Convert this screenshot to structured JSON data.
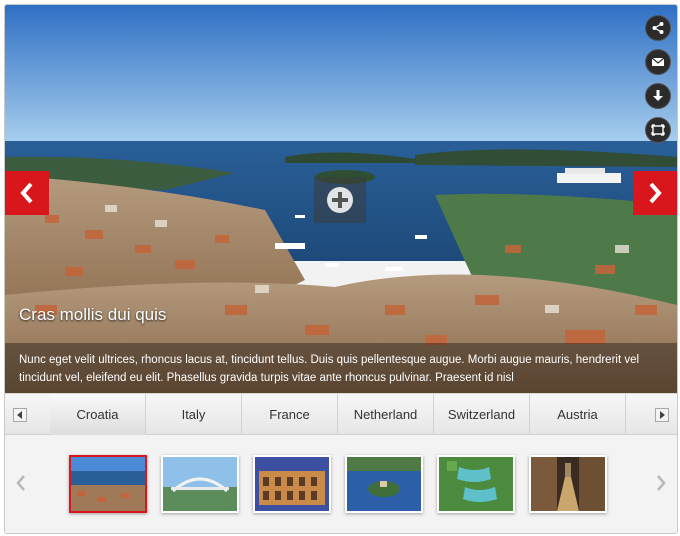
{
  "slide": {
    "title": "Cras mollis dui quis",
    "description": "Nunc eget velit ultrices, rhoncus lacus at, tincidunt tellus. Duis quis pellentesque augue. Morbi augue mauris, hendrerit vel tincidunt vel, eleifend eu elit. Phasellus gravida turpis vitae ante rhoncus pulvinar. Praesent id nisl"
  },
  "tools": [
    "share-icon",
    "mail-icon",
    "download-icon",
    "fullscreen-icon"
  ],
  "tabs": [
    "Croatia",
    "Italy",
    "France",
    "Netherland",
    "Switzerland",
    "Austria"
  ],
  "active_tab": "Croatia",
  "thumbnails": [
    {
      "subject": "coastal-town"
    },
    {
      "subject": "bridge"
    },
    {
      "subject": "colosseum"
    },
    {
      "subject": "lake-island"
    },
    {
      "subject": "waterfalls"
    },
    {
      "subject": "old-street"
    }
  ],
  "colors": {
    "accent": "#d8161c",
    "sky": "#2f7fd0",
    "sea": "#1f5e99"
  }
}
